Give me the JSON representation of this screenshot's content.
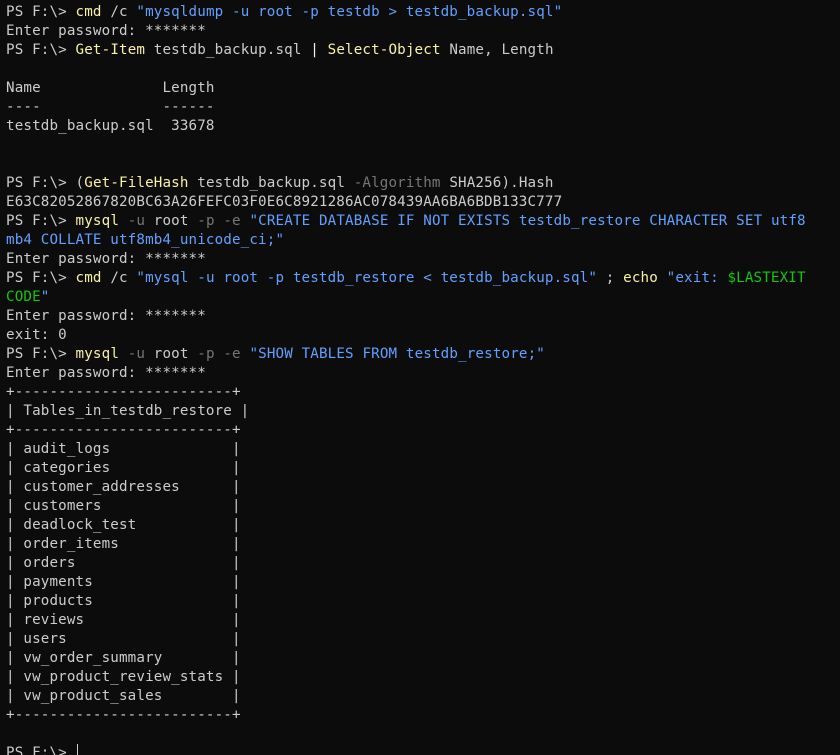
{
  "prompt": "PS F:\\> ",
  "colors": {
    "background": "#0c0c0c",
    "foreground": "#cccccc",
    "command": "#f9f1a5",
    "string": "#3b78ff",
    "parameter": "#767676",
    "variable": "#16c60c"
  },
  "lines": [
    [
      {
        "t": "PS F:\\> ",
        "c": "prompt"
      },
      {
        "t": "cmd",
        "c": "cmd"
      },
      {
        "t": " /c ",
        "c": "out"
      },
      {
        "t": "\"mysqldump -u root -p testdb > testdb_backup.sql\"",
        "c": "str2"
      }
    ],
    [
      {
        "t": "Enter password: *******",
        "c": "out"
      }
    ],
    [
      {
        "t": "PS F:\\> ",
        "c": "prompt"
      },
      {
        "t": "Get-Item",
        "c": "cmd"
      },
      {
        "t": " testdb_backup.sql ",
        "c": "out"
      },
      {
        "t": "|",
        "c": "bold"
      },
      {
        "t": " ",
        "c": "out"
      },
      {
        "t": "Select-Object",
        "c": "cmd"
      },
      {
        "t": " Name, Length",
        "c": "out"
      }
    ],
    [
      {
        "t": "",
        "c": "out"
      }
    ],
    [
      {
        "t": "Name              Length",
        "c": "out"
      }
    ],
    [
      {
        "t": "----              ------",
        "c": "out"
      }
    ],
    [
      {
        "t": "testdb_backup.sql  33678",
        "c": "out"
      }
    ],
    [
      {
        "t": "",
        "c": "out"
      }
    ],
    [
      {
        "t": "",
        "c": "out"
      }
    ],
    [
      {
        "t": "PS F:\\> ",
        "c": "prompt"
      },
      {
        "t": "(",
        "c": "out"
      },
      {
        "t": "Get-FileHash",
        "c": "cmd"
      },
      {
        "t": " testdb_backup.sql ",
        "c": "out"
      },
      {
        "t": "-Algorithm",
        "c": "param"
      },
      {
        "t": " SHA256).Hash",
        "c": "out"
      }
    ],
    [
      {
        "t": "E63C82052867820BC63A26FEFC03F0E6C8921286AC078439AA6BA6BDB133C777",
        "c": "out"
      }
    ],
    [
      {
        "t": "PS F:\\> ",
        "c": "prompt"
      },
      {
        "t": "mysql",
        "c": "cmd"
      },
      {
        "t": " ",
        "c": "out"
      },
      {
        "t": "-u",
        "c": "param"
      },
      {
        "t": " root ",
        "c": "out"
      },
      {
        "t": "-p",
        "c": "param"
      },
      {
        "t": " ",
        "c": "out"
      },
      {
        "t": "-e",
        "c": "param"
      },
      {
        "t": " ",
        "c": "out"
      },
      {
        "t": "\"CREATE DATABASE IF NOT EXISTS testdb_restore CHARACTER SET utf8",
        "c": "str2"
      }
    ],
    [
      {
        "t": "mb4 COLLATE utf8mb4_unicode_ci;\"",
        "c": "str2"
      }
    ],
    [
      {
        "t": "Enter password: *******",
        "c": "out"
      }
    ],
    [
      {
        "t": "PS F:\\> ",
        "c": "prompt"
      },
      {
        "t": "cmd",
        "c": "cmd"
      },
      {
        "t": " /c ",
        "c": "out"
      },
      {
        "t": "\"mysql -u root -p testdb_restore < testdb_backup.sql\"",
        "c": "str2"
      },
      {
        "t": " ; ",
        "c": "out"
      },
      {
        "t": "echo",
        "c": "cmd"
      },
      {
        "t": " ",
        "c": "out"
      },
      {
        "t": "\"exit: ",
        "c": "str2"
      },
      {
        "t": "$LASTEXIT",
        "c": "var"
      }
    ],
    [
      {
        "t": "CODE",
        "c": "var"
      },
      {
        "t": "\"",
        "c": "str2"
      }
    ],
    [
      {
        "t": "Enter password: *******",
        "c": "out"
      }
    ],
    [
      {
        "t": "exit: 0",
        "c": "out"
      }
    ],
    [
      {
        "t": "PS F:\\> ",
        "c": "prompt"
      },
      {
        "t": "mysql",
        "c": "cmd"
      },
      {
        "t": " ",
        "c": "out"
      },
      {
        "t": "-u",
        "c": "param"
      },
      {
        "t": " root ",
        "c": "out"
      },
      {
        "t": "-p",
        "c": "param"
      },
      {
        "t": " ",
        "c": "out"
      },
      {
        "t": "-e",
        "c": "param"
      },
      {
        "t": " ",
        "c": "out"
      },
      {
        "t": "\"SHOW TABLES FROM testdb_restore;\"",
        "c": "str2"
      }
    ],
    [
      {
        "t": "Enter password: *******",
        "c": "out"
      }
    ],
    [
      {
        "t": "+-------------------------+",
        "c": "out"
      }
    ],
    [
      {
        "t": "| Tables_in_testdb_restore |",
        "c": "out"
      }
    ],
    [
      {
        "t": "+-------------------------+",
        "c": "out"
      }
    ],
    [
      {
        "t": "| audit_logs              |",
        "c": "out"
      }
    ],
    [
      {
        "t": "| categories              |",
        "c": "out"
      }
    ],
    [
      {
        "t": "| customer_addresses      |",
        "c": "out"
      }
    ],
    [
      {
        "t": "| customers               |",
        "c": "out"
      }
    ],
    [
      {
        "t": "| deadlock_test           |",
        "c": "out"
      }
    ],
    [
      {
        "t": "| order_items             |",
        "c": "out"
      }
    ],
    [
      {
        "t": "| orders                  |",
        "c": "out"
      }
    ],
    [
      {
        "t": "| payments                |",
        "c": "out"
      }
    ],
    [
      {
        "t": "| products                |",
        "c": "out"
      }
    ],
    [
      {
        "t": "| reviews                 |",
        "c": "out"
      }
    ],
    [
      {
        "t": "| users                   |",
        "c": "out"
      }
    ],
    [
      {
        "t": "| vw_order_summary        |",
        "c": "out"
      }
    ],
    [
      {
        "t": "| vw_product_review_stats |",
        "c": "out"
      }
    ],
    [
      {
        "t": "| vw_product_sales        |",
        "c": "out"
      }
    ],
    [
      {
        "t": "+-------------------------+",
        "c": "out"
      }
    ],
    [
      {
        "t": "",
        "c": "out"
      }
    ]
  ]
}
